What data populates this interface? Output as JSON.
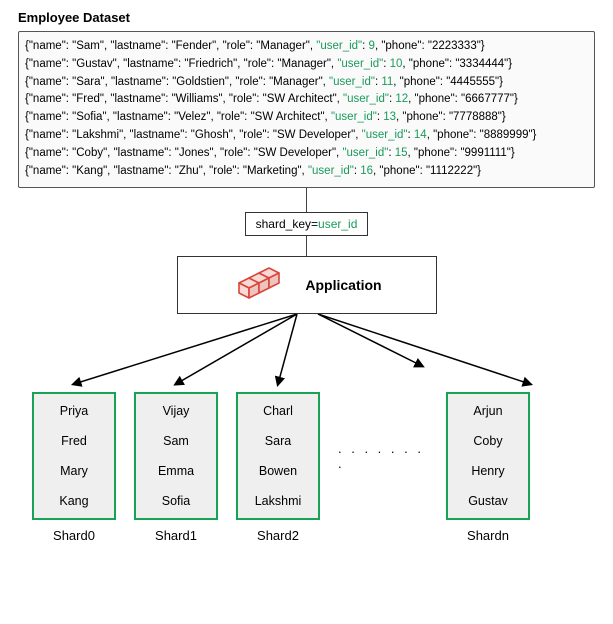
{
  "title": "Employee Dataset",
  "dataset": {
    "records": [
      {
        "name": "Sam",
        "lastname": "Fender",
        "role": "Manager",
        "user_id": 9,
        "phone": "2223333"
      },
      {
        "name": "Gustav",
        "lastname": "Friedrich",
        "role": "Manager",
        "user_id": 10,
        "phone": "3334444"
      },
      {
        "name": "Sara",
        "lastname": "Goldstien",
        "role": "Manager",
        "user_id": 11,
        "phone": "4445555"
      },
      {
        "name": "Fred",
        "lastname": "Williams",
        "role": "SW Architect",
        "user_id": 12,
        "phone": "6667777"
      },
      {
        "name": "Sofia",
        "lastname": "Velez",
        "role": "SW Architect",
        "user_id": 13,
        "phone": "7778888"
      },
      {
        "name": "Lakshmi",
        "lastname": "Ghosh",
        "role": "SW Developer",
        "user_id": 14,
        "phone": "8889999"
      },
      {
        "name": "Coby",
        "lastname": "Jones",
        "role": "SW Developer",
        "user_id": 15,
        "phone": "9991111"
      },
      {
        "name": "Kang",
        "lastname": "Zhu",
        "role": "Marketing",
        "user_id": 16,
        "phone": "1112222"
      }
    ]
  },
  "shard_key": {
    "key_label": "shard_key",
    "value": "user_id"
  },
  "application": {
    "label": "Application"
  },
  "shards": [
    {
      "label": "Shard0",
      "items": [
        "Priya",
        "Fred",
        "Mary",
        "Kang"
      ]
    },
    {
      "label": "Shard1",
      "items": [
        "Vijay",
        "Sam",
        "Emma",
        "Sofia"
      ]
    },
    {
      "label": "Shard2",
      "items": [
        "Charl",
        "Sara",
        "Bowen",
        "Lakshmi"
      ]
    },
    {
      "label": "Shardn",
      "items": [
        "Arjun",
        "Coby",
        "Henry",
        "Gustav"
      ]
    }
  ],
  "ellipsis": ". . . . . . . ."
}
